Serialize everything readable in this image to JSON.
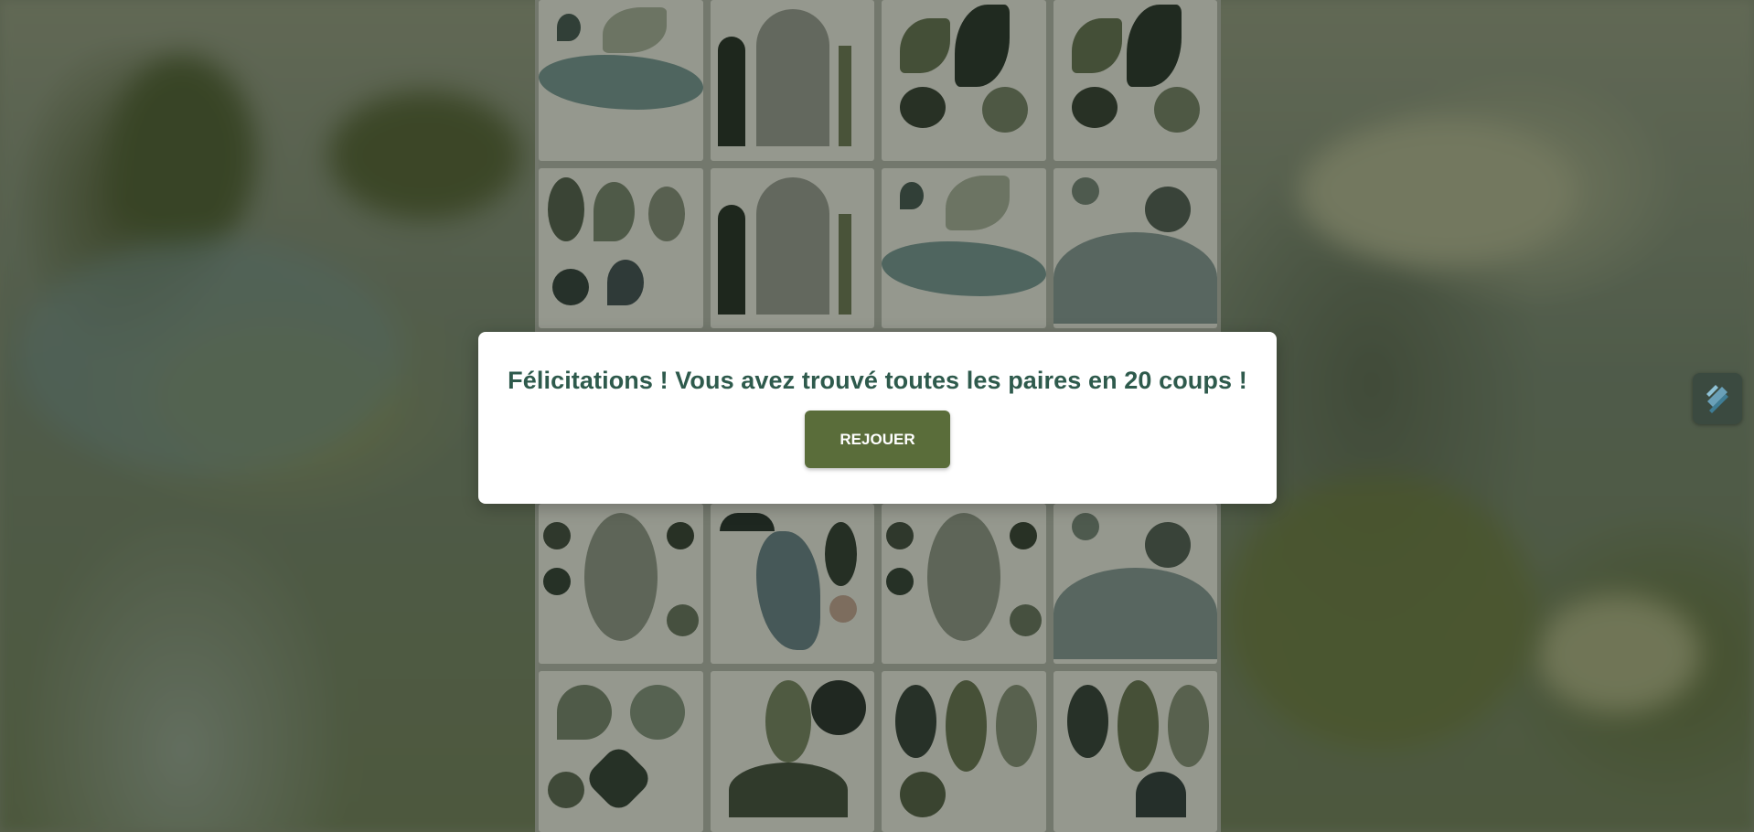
{
  "dialog": {
    "message": "Félicitations ! Vous avez trouvé toutes les paires en 20 coups !",
    "replay_label": "REJOUER"
  },
  "board": {
    "rows": 5,
    "columns": 4,
    "cards": [
      {
        "motif": "wave-leaves"
      },
      {
        "motif": "arches"
      },
      {
        "motif": "tulips"
      },
      {
        "motif": "tulips"
      },
      {
        "motif": "leaf-grid"
      },
      {
        "motif": "arches"
      },
      {
        "motif": "wave-leaves"
      },
      {
        "motif": "hills-flower"
      },
      {
        "motif": "hidden"
      },
      {
        "motif": "hidden"
      },
      {
        "motif": "hidden"
      },
      {
        "motif": "hidden"
      },
      {
        "motif": "round-leaves"
      },
      {
        "motif": "river"
      },
      {
        "motif": "round-leaves"
      },
      {
        "motif": "hills-flower"
      },
      {
        "motif": "mixed-plants"
      },
      {
        "motif": "sprouts"
      },
      {
        "motif": "ferns"
      },
      {
        "motif": "ferns"
      }
    ]
  },
  "side_tool": {
    "icon": "pen-tool-icon"
  },
  "colors": {
    "accent": "#5a6d3a",
    "title": "#2e5a4c",
    "overlay": "rgba(30,34,28,0.38)"
  }
}
